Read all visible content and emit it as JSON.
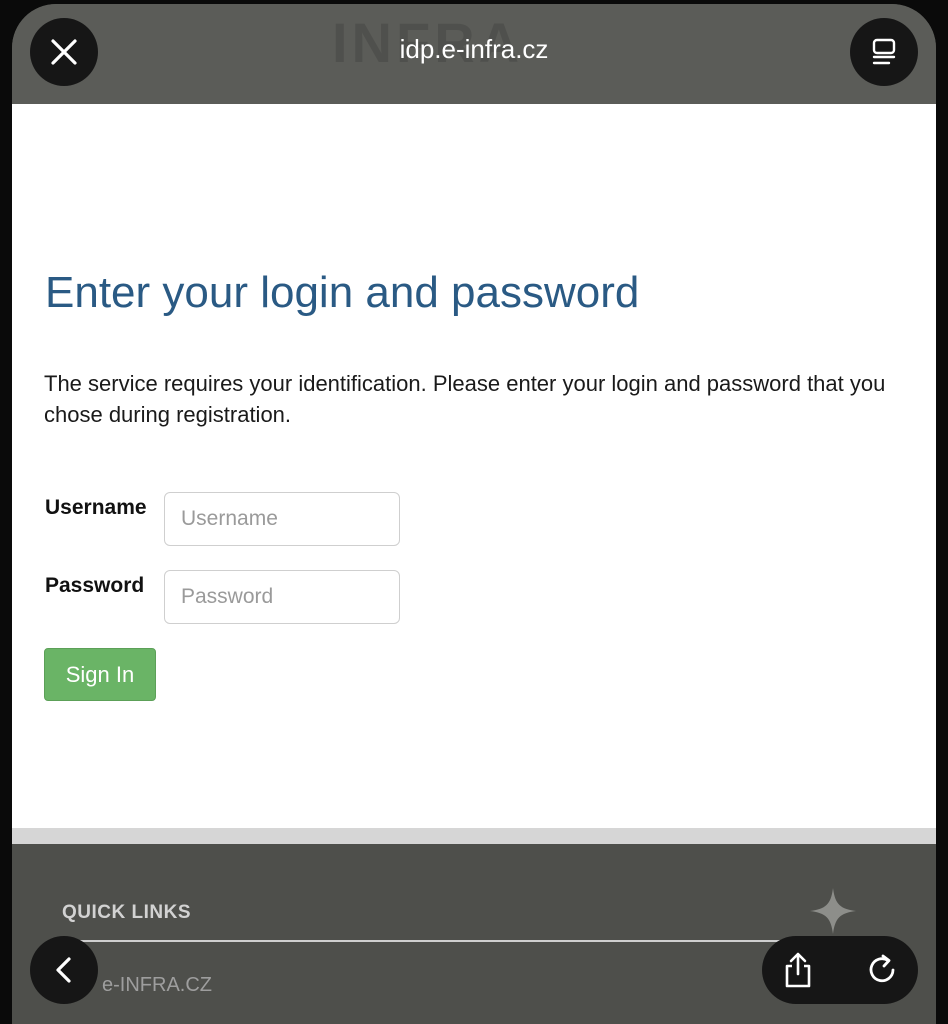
{
  "browser": {
    "url": "idp.e-infra.cz",
    "watermark": "INFRA",
    "icons": {
      "close": "close-icon",
      "reader": "reader-mode-icon",
      "back": "chevron-left-icon",
      "share": "share-icon",
      "reload": "reload-icon"
    }
  },
  "login": {
    "title": "Enter your login and password",
    "intro": "The service requires your identification. Please enter your login and password that you chose during registration.",
    "username_label": "Username",
    "username_placeholder": "Username",
    "password_label": "Password",
    "password_placeholder": "Password",
    "signin_label": "Sign In"
  },
  "footer": {
    "quick_links_title": "QUICK LINKS",
    "links": [
      "e-INFRA.CZ"
    ]
  },
  "colors": {
    "title": "#2a5a84",
    "signin_button": "#6ab466",
    "footer_bg": "#4e4f4b"
  }
}
